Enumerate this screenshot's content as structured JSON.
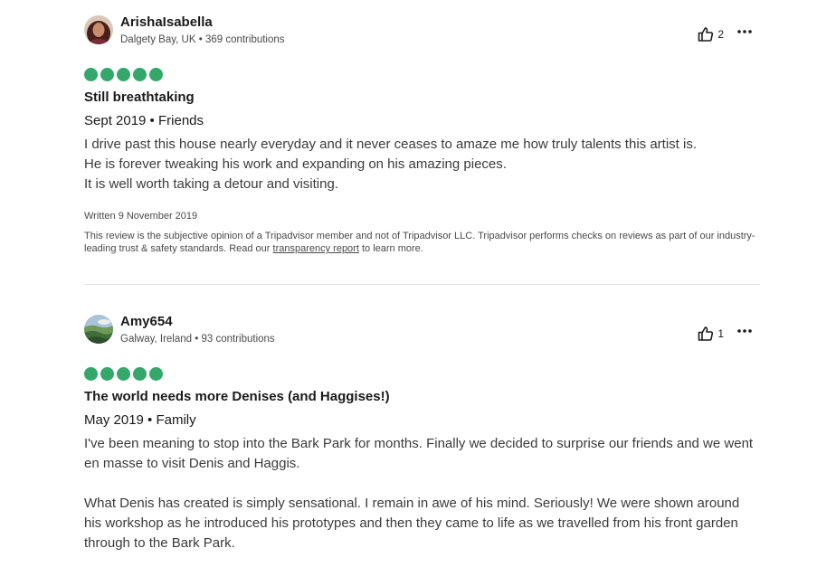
{
  "reviews": [
    {
      "username": "ArishaIsabella",
      "location": "Dalgety Bay, UK",
      "separator": " • ",
      "contributions": "369 contributions",
      "helpful_count": "2",
      "rating": 5,
      "title": "Still breathtaking",
      "visit": "Sept 2019 • Friends",
      "body": [
        "I drive past this house nearly everyday and it never ceases to amaze me how truly talents this artist is.",
        "He is forever tweaking his work and expanding on his amazing pieces.",
        "It is well worth taking a detour and visiting."
      ],
      "written_date": "Written 9 November 2019",
      "disclaimer_before": "This review is the subjective opinion of a Tripadvisor member and not of Tripadvisor LLC. Tripadvisor performs checks on reviews as part of our industry-leading trust & safety standards. Read our ",
      "disclaimer_link": "transparency report",
      "disclaimer_after": " to learn more."
    },
    {
      "username": "Amy654",
      "location": "Galway, Ireland",
      "separator": " • ",
      "contributions": "93 contributions",
      "helpful_count": "1",
      "rating": 5,
      "title": "The world needs more Denises (and Haggises!)",
      "visit": "May 2019 • Family",
      "body": [
        "I've been meaning to stop into the Bark Park for months. Finally we decided to surprise our friends and we went en masse to visit Denis and Haggis.",
        "What Denis has created is simply sensational. I remain in awe of his mind. Seriously! We were shown around his workshop as he introduced his prototypes and then they came to life as we travelled from his front garden through to the Bark Park."
      ]
    }
  ],
  "colors": {
    "rating_bubble": "#34a86b",
    "divider": "#e0e0e0"
  },
  "icons": {
    "helpful": "thumbs-up-icon",
    "more": "more-options-icon"
  }
}
